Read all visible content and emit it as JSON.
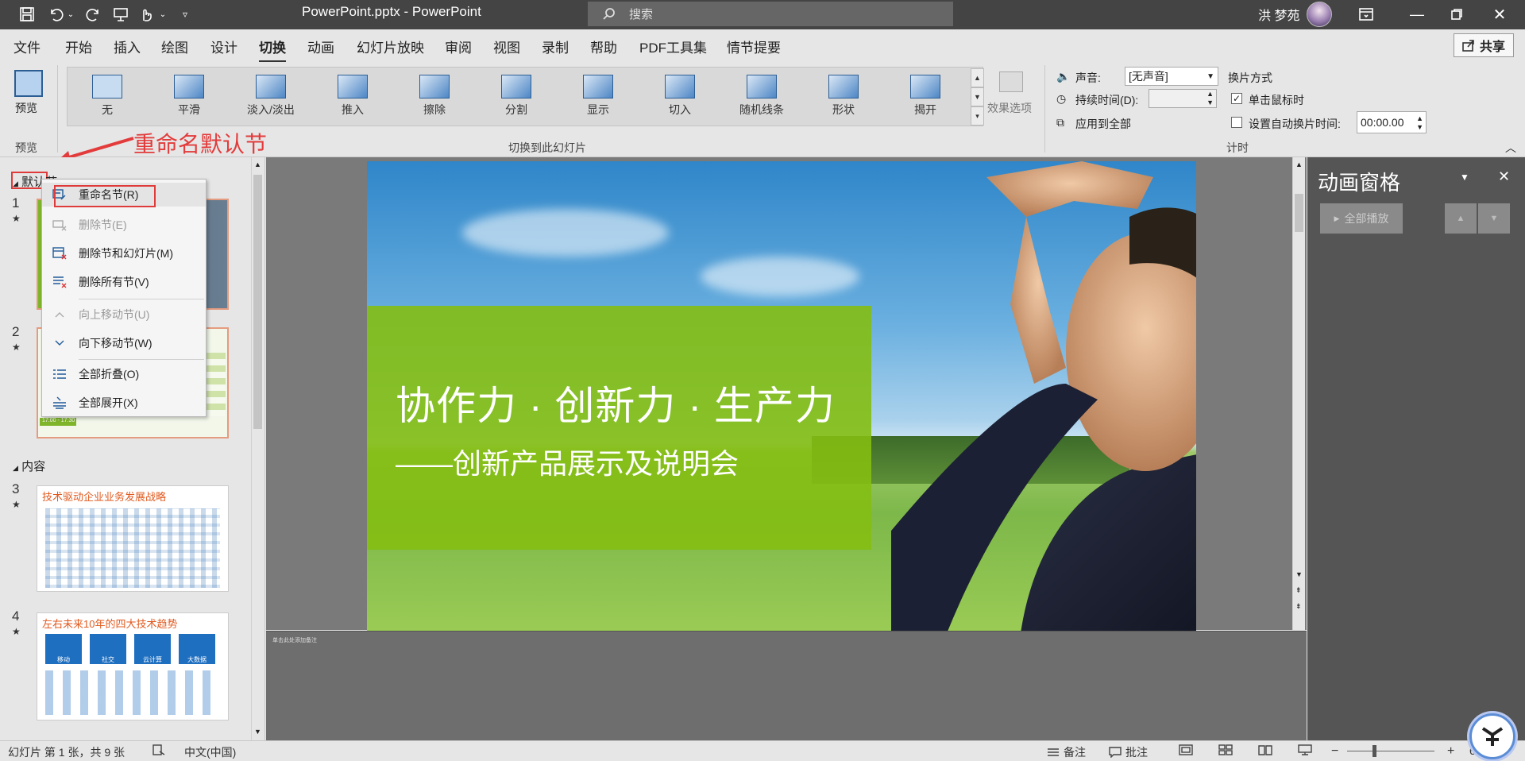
{
  "window": {
    "title": "PowerPoint.pptx  -  PowerPoint",
    "search_placeholder": "搜索",
    "user_name": "洪 梦苑"
  },
  "menu": {
    "tabs": [
      "文件",
      "开始",
      "插入",
      "绘图",
      "设计",
      "切换",
      "动画",
      "幻灯片放映",
      "审阅",
      "视图",
      "录制",
      "帮助",
      "PDF工具集",
      "情节提要"
    ],
    "active_tab": "切换",
    "share_label": "共享"
  },
  "ribbon": {
    "preview_label": "预览",
    "preview_group": "预览",
    "transitions": [
      "无",
      "平滑",
      "淡入/淡出",
      "推入",
      "擦除",
      "分割",
      "显示",
      "切入",
      "随机线条",
      "形状",
      "揭开"
    ],
    "effect_options": "效果选项",
    "transition_group": "切换到此幻灯片",
    "sound_label": "声音:",
    "sound_value": "[无声音]",
    "duration_label": "持续时间(D):",
    "apply_all": "应用到全部",
    "advance_label": "换片方式",
    "on_click": "单击鼠标时",
    "on_click_checked": true,
    "auto_after": "设置自动换片时间:",
    "auto_after_value": "00:00.00",
    "timing_group": "计时"
  },
  "annotation": {
    "text": "重命名默认节",
    "color": "#e33b3b"
  },
  "slides_panel": {
    "section_default": "默认节",
    "section_content": "内容",
    "slides": [
      {
        "num": "1",
        "star": "★"
      },
      {
        "num": "2",
        "star": "★"
      },
      {
        "num": "3",
        "star": "★",
        "title": "技术驱动企业业务发展战略"
      },
      {
        "num": "4",
        "star": "★",
        "title": "左右未来10年的四大技术趋势",
        "icons": [
          "移动",
          "社交",
          "云计算",
          "大数据"
        ]
      }
    ],
    "slide2_footer": "17:00 - 17:30"
  },
  "context_menu": {
    "items": [
      {
        "label": "重命名节(R)",
        "enabled": true,
        "icon": "rename-section-icon"
      },
      {
        "label": "删除节(E)",
        "enabled": false,
        "icon": "remove-section-icon"
      },
      {
        "label": "删除节和幻灯片(M)",
        "enabled": true,
        "icon": "remove-section-slides-icon"
      },
      {
        "label": "删除所有节(V)",
        "enabled": true,
        "icon": "remove-all-sections-icon"
      },
      {
        "label": "向上移动节(U)",
        "enabled": false,
        "icon": "chevron-up-icon"
      },
      {
        "label": "向下移动节(W)",
        "enabled": true,
        "icon": "chevron-down-icon"
      },
      {
        "label": "全部折叠(O)",
        "enabled": true,
        "icon": "collapse-all-icon"
      },
      {
        "label": "全部展开(X)",
        "enabled": true,
        "icon": "expand-all-icon"
      }
    ]
  },
  "slide": {
    "title": "协作力 · 创新力 · 生产力",
    "subtitle": "——创新产品展示及说明会",
    "accent": "#84be12"
  },
  "notes": {
    "text": "单击此处添加备注"
  },
  "animation_pane": {
    "title": "动画窗格",
    "play_all": "全部播放"
  },
  "status": {
    "slide_info": "幻灯片 第 1 张，共 9 张",
    "language": "中文(中国)",
    "notes": "备注",
    "comments": "批注",
    "zoom": "63%"
  }
}
